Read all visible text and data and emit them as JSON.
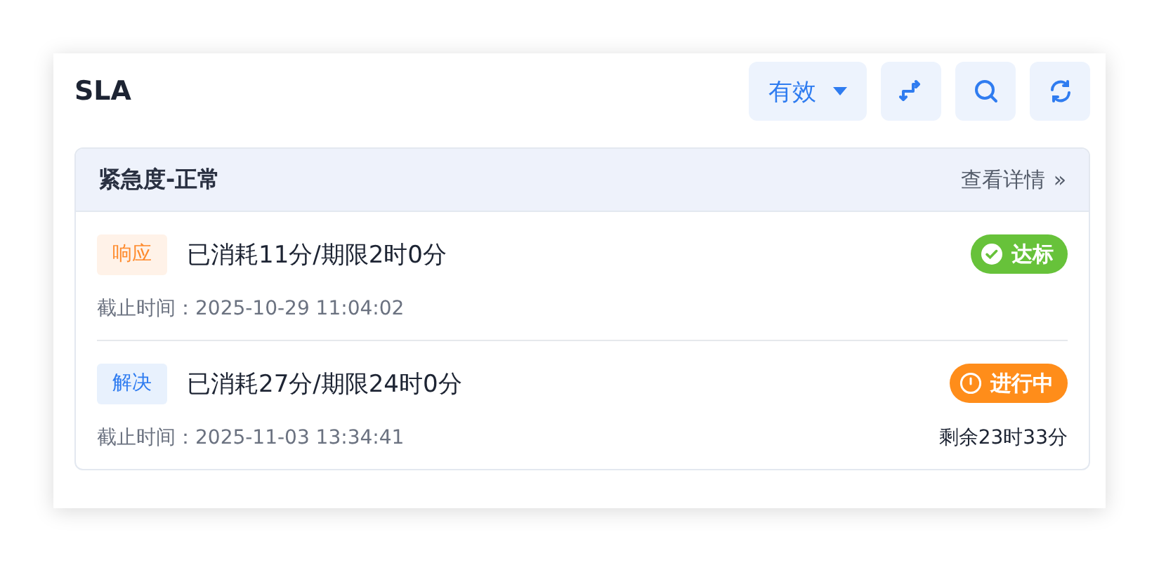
{
  "card": {
    "title": "SLA",
    "filter": {
      "label": "有效"
    }
  },
  "section": {
    "title": "紧急度-正常",
    "detail_link": "查看详情",
    "detail_icon": "»"
  },
  "items": [
    {
      "tag": "响应",
      "color": "#ff8a2b",
      "summary": "已消耗11分/期限2时0分",
      "deadline": "截止时间：2025-10-29 11:04:02",
      "status": {
        "kind": "met",
        "label": "达标"
      }
    },
    {
      "tag": "解决",
      "color": "#2f7cf0",
      "summary": "已消耗27分/期限24时0分",
      "deadline": "截止时间：2025-11-03 13:34:41",
      "status": {
        "kind": "in_progress",
        "label": "进行中"
      },
      "remaining": "剩余23时33分"
    }
  ]
}
